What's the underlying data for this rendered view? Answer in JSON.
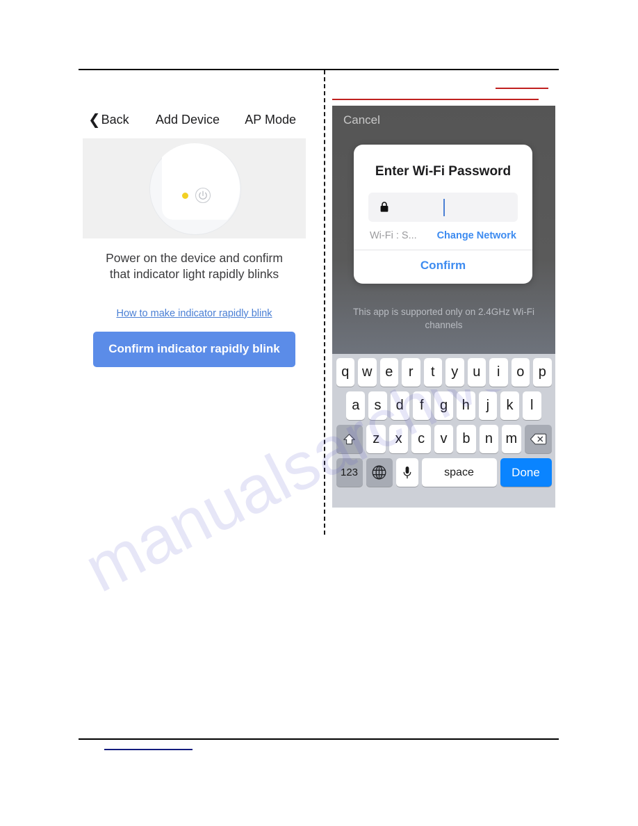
{
  "left_screen": {
    "nav": {
      "back_label": "Back",
      "title": "Add Device",
      "mode_label": "AP Mode"
    },
    "device_illustration": {
      "led_color": "#f2d024",
      "power_icon": "power-icon"
    },
    "instruction_line1": "Power on the device and confirm",
    "instruction_line2": "that indicator light rapidly blinks",
    "help_link": "How to make indicator rapidly blink",
    "primary_button": "Confirm indicator rapidly blink",
    "accent_color": "#5b8ce8"
  },
  "right_screen": {
    "cancel_label": "Cancel",
    "dialog": {
      "title": "Enter Wi-Fi Password",
      "password_value": "",
      "password_placeholder": "",
      "lock_icon": "lock-icon",
      "ssid_label": "Wi-Fi : S...",
      "change_network_label": "Change Network",
      "confirm_label": "Confirm"
    },
    "hint_text": "This app is supported only on 2.4GHz Wi-Fi channels",
    "keyboard": {
      "row1": [
        "q",
        "w",
        "e",
        "r",
        "t",
        "y",
        "u",
        "i",
        "o",
        "p"
      ],
      "row2": [
        "a",
        "s",
        "d",
        "f",
        "g",
        "h",
        "j",
        "k",
        "l"
      ],
      "row3": [
        "z",
        "x",
        "c",
        "v",
        "b",
        "n",
        "m"
      ],
      "shift_icon": "shift-icon",
      "backspace_icon": "backspace-icon",
      "numeric_label": "123",
      "globe_icon": "globe-icon",
      "mic_icon": "microphone-icon",
      "space_label": "space",
      "done_label": "Done",
      "done_color": "#0a84ff"
    }
  },
  "watermark": {
    "text": "manualsarchive.com"
  }
}
